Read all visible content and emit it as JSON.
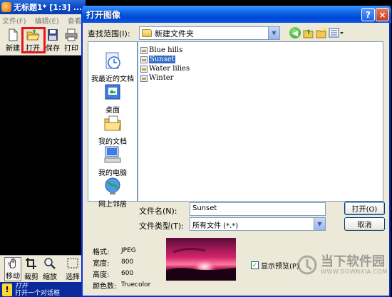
{
  "app": {
    "title": "无标题1* [1:3] ...",
    "menu": [
      "文件(F)",
      "编辑(E)",
      "查看"
    ],
    "toolbar": {
      "new_label": "新建",
      "open_label": "打开",
      "save_label": "保存",
      "print_label": "打印"
    },
    "tools": {
      "move_label": "移动",
      "crop_label": "裁剪",
      "zoom_label": "缩放",
      "select_label": "选择"
    },
    "hint": {
      "title": "打开",
      "text": "打开一个对话框"
    }
  },
  "dialog": {
    "title": "打开图像",
    "help": "?",
    "close": "×",
    "lookin_label": "查找范围(I):",
    "lookin_value": "新建文件夹",
    "places": [
      {
        "label": "我最近的文档"
      },
      {
        "label": "桌面"
      },
      {
        "label": "我的文档"
      },
      {
        "label": "我的电脑"
      },
      {
        "label": "网上邻居"
      }
    ],
    "files": [
      {
        "name": "Blue hills",
        "selected": false
      },
      {
        "name": "Sunset",
        "selected": true
      },
      {
        "name": "Water lilies",
        "selected": false
      },
      {
        "name": "Winter",
        "selected": false
      }
    ],
    "filename_label": "文件名(N):",
    "filename_value": "Sunset",
    "filetype_label": "文件类型(T):",
    "filetype_value": "所有文件 (*.*)",
    "open_button": "打开(O)",
    "cancel_button": "取消",
    "info": [
      {
        "key": "格式:",
        "value": "JPEG"
      },
      {
        "key": "宽度:",
        "value": "800"
      },
      {
        "key": "高度:",
        "value": "600"
      },
      {
        "key": "颜色数:",
        "value": "Truecolor"
      }
    ],
    "preview_label": "显示预览(P)",
    "preview_checked": true
  },
  "watermark": {
    "text": "当下软件园",
    "url": "WWW.DOWNXIA.COM"
  },
  "colors": {
    "titlebar": "#0a5fe2",
    "selection": "#316ac5",
    "highlight_box": "#e8141a"
  }
}
